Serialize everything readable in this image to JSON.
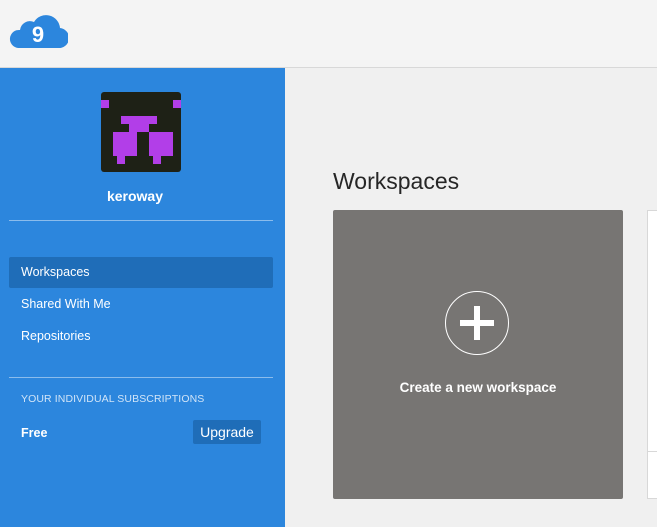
{
  "header": {
    "logo_icon": "cloud9-logo-icon",
    "logo_text": "9"
  },
  "sidebar": {
    "avatar_icon": "pixel-avatar-icon",
    "username": "keroway",
    "nav": [
      {
        "label": "Workspaces",
        "active": true
      },
      {
        "label": "Shared With Me",
        "active": false
      },
      {
        "label": "Repositories",
        "active": false
      }
    ],
    "subscriptions": {
      "heading": "YOUR INDIVIDUAL SUBSCRIPTIONS",
      "plan": "Free",
      "upgrade_label": "Upgrade"
    }
  },
  "main": {
    "title": "Workspaces",
    "create_card": {
      "label": "Create a new workspace",
      "icon": "plus-icon"
    }
  },
  "colors": {
    "sidebar_bg": "#2c86dd",
    "sidebar_active": "#1f6db8",
    "card_bg": "#777573",
    "logo_blue": "#2c86dd",
    "avatar_purple": "#b23ee8"
  }
}
